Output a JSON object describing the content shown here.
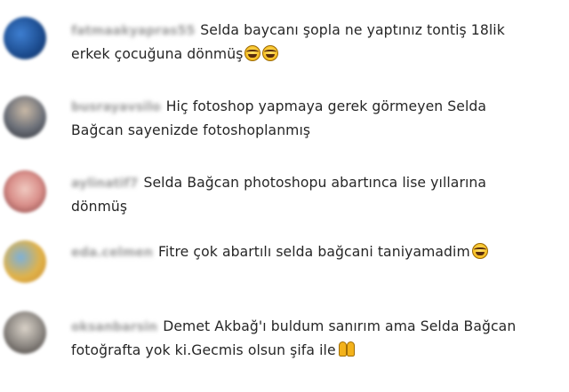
{
  "comments": [
    {
      "username": "fatmaakyapras55",
      "lines": [
        "Selda baycanı şopla ne yaptınız tontiş 18lik",
        "erkek çocuğuna dönmüş"
      ],
      "emoji": [
        "face-with-tears-of-joy",
        "face-with-tears-of-joy"
      ],
      "avatar_colors": [
        "#1e4f93",
        "#3e7fd1",
        "#0a2a5c"
      ]
    },
    {
      "username": "busrayavsilo",
      "lines": [
        "Hiç fotoshop yapmaya gerek görmeyen Selda",
        "Bağcan sayenizde fotoshoplanmış"
      ],
      "emoji": [],
      "avatar_colors": [
        "#6b6f78",
        "#c9b9a6",
        "#2d2f35"
      ]
    },
    {
      "username": "aylinatif7",
      "lines": [
        "Selda Bağcan photoshopu abartınca lise yıllarına",
        "dönmüş"
      ],
      "emoji": [],
      "avatar_colors": [
        "#d98f8a",
        "#f0c9c0",
        "#7d3a3a"
      ]
    },
    {
      "username": "eda.celmen",
      "lines": [
        "Fitre çok abartılı selda bağcani taniyamadim"
      ],
      "emoji": [
        "face-with-tears-of-joy"
      ],
      "avatar_colors": [
        "#e0b24a",
        "#7db1d9",
        "#c98a2c"
      ]
    },
    {
      "username": "oksanbarsin",
      "lines": [
        "Demet Akbağ'ı buldum sanırım ama Selda Bağcan",
        "fotoğrafta yok ki.Gecmis olsun şifa ile"
      ],
      "emoji": [
        "folded-hands"
      ],
      "avatar_colors": [
        "#8a8580",
        "#d9d2c8",
        "#3a3532"
      ]
    }
  ]
}
